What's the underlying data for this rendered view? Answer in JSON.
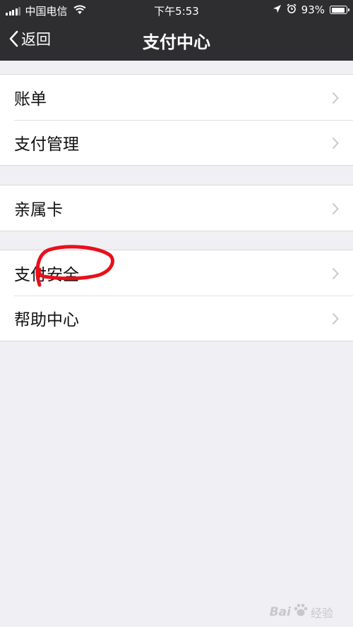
{
  "status_bar": {
    "carrier": "中国电信",
    "time": "下午5:53",
    "battery_percent": "93%",
    "battery_level": 0.93
  },
  "nav": {
    "back_label": "返回",
    "title": "支付中心"
  },
  "groups": [
    {
      "items": [
        {
          "label": "账单"
        },
        {
          "label": "支付管理"
        }
      ]
    },
    {
      "items": [
        {
          "label": "亲属卡"
        }
      ]
    },
    {
      "items": [
        {
          "label": "支付安全"
        },
        {
          "label": "帮助中心"
        }
      ]
    }
  ],
  "watermark": {
    "brand_left": "Bai",
    "brand_right": "经验"
  },
  "colors": {
    "nav_bar": "#2e2e31",
    "background": "#efeff4",
    "annotation": "#e8101a"
  }
}
